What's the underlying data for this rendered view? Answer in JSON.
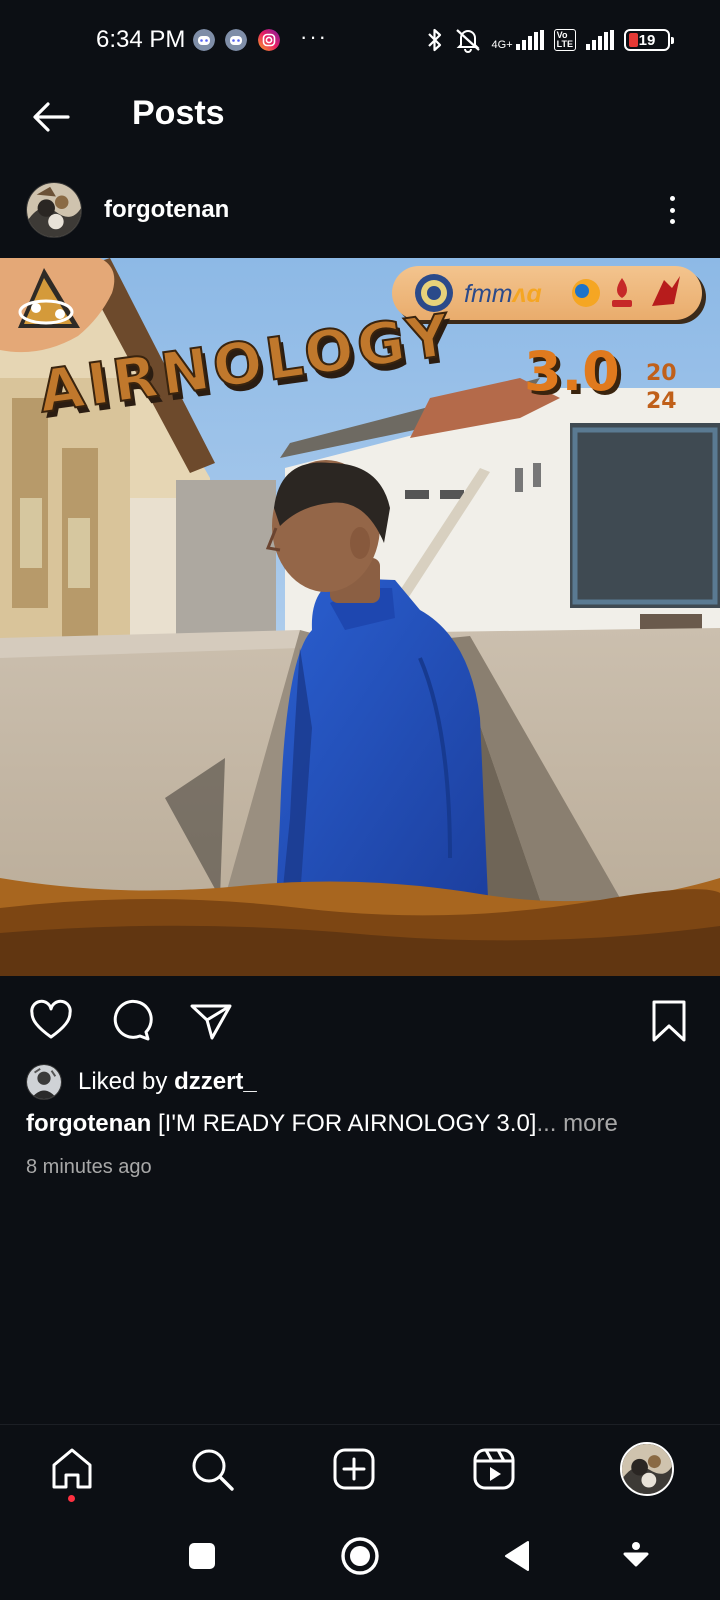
{
  "status_bar": {
    "time": "6:34 PM",
    "notification_icons": [
      "discord-icon",
      "discord-icon",
      "instagram-icon"
    ],
    "overflow": "···",
    "network_type": "4G+",
    "volte_label": "Vo\nLTE",
    "battery_level": "19",
    "icons": [
      "bluetooth-icon",
      "mute-icon",
      "signal-icon",
      "signal-icon",
      "battery-icon"
    ]
  },
  "header": {
    "title": "Posts",
    "back_icon": "arrow-left-icon"
  },
  "post": {
    "username": "forgotenan",
    "image": {
      "headline": "AIRNOLOGY",
      "version": "3.0",
      "year_top": "20",
      "year_bottom": "24",
      "sponsor_text": "fmm"
    },
    "liked_prefix": "Liked by ",
    "liked_by": "dzzert_",
    "caption_user": "forgotenan",
    "caption_text": " [I'M READY FOR AIRNOLOGY 3.0]",
    "caption_more": "... more",
    "timestamp": "8 minutes ago"
  },
  "actions": [
    "heart-icon",
    "comment-icon",
    "share-icon",
    "bookmark-icon"
  ],
  "bottom_nav": [
    "home-icon",
    "search-icon",
    "create-icon",
    "reels-icon",
    "profile-avatar"
  ],
  "system_nav": [
    "recents-icon",
    "home-circle-icon",
    "back-triangle-icon",
    "assistant-icon"
  ],
  "colors": {
    "background": "#0c0f14",
    "text": "#f5f5f5",
    "muted_text": "#a8a8a8",
    "notification_dot": "#ff3040",
    "battery_low": "#e53935",
    "poster_orange": "#e07a1e",
    "poster_brown": "#6b3a12"
  }
}
